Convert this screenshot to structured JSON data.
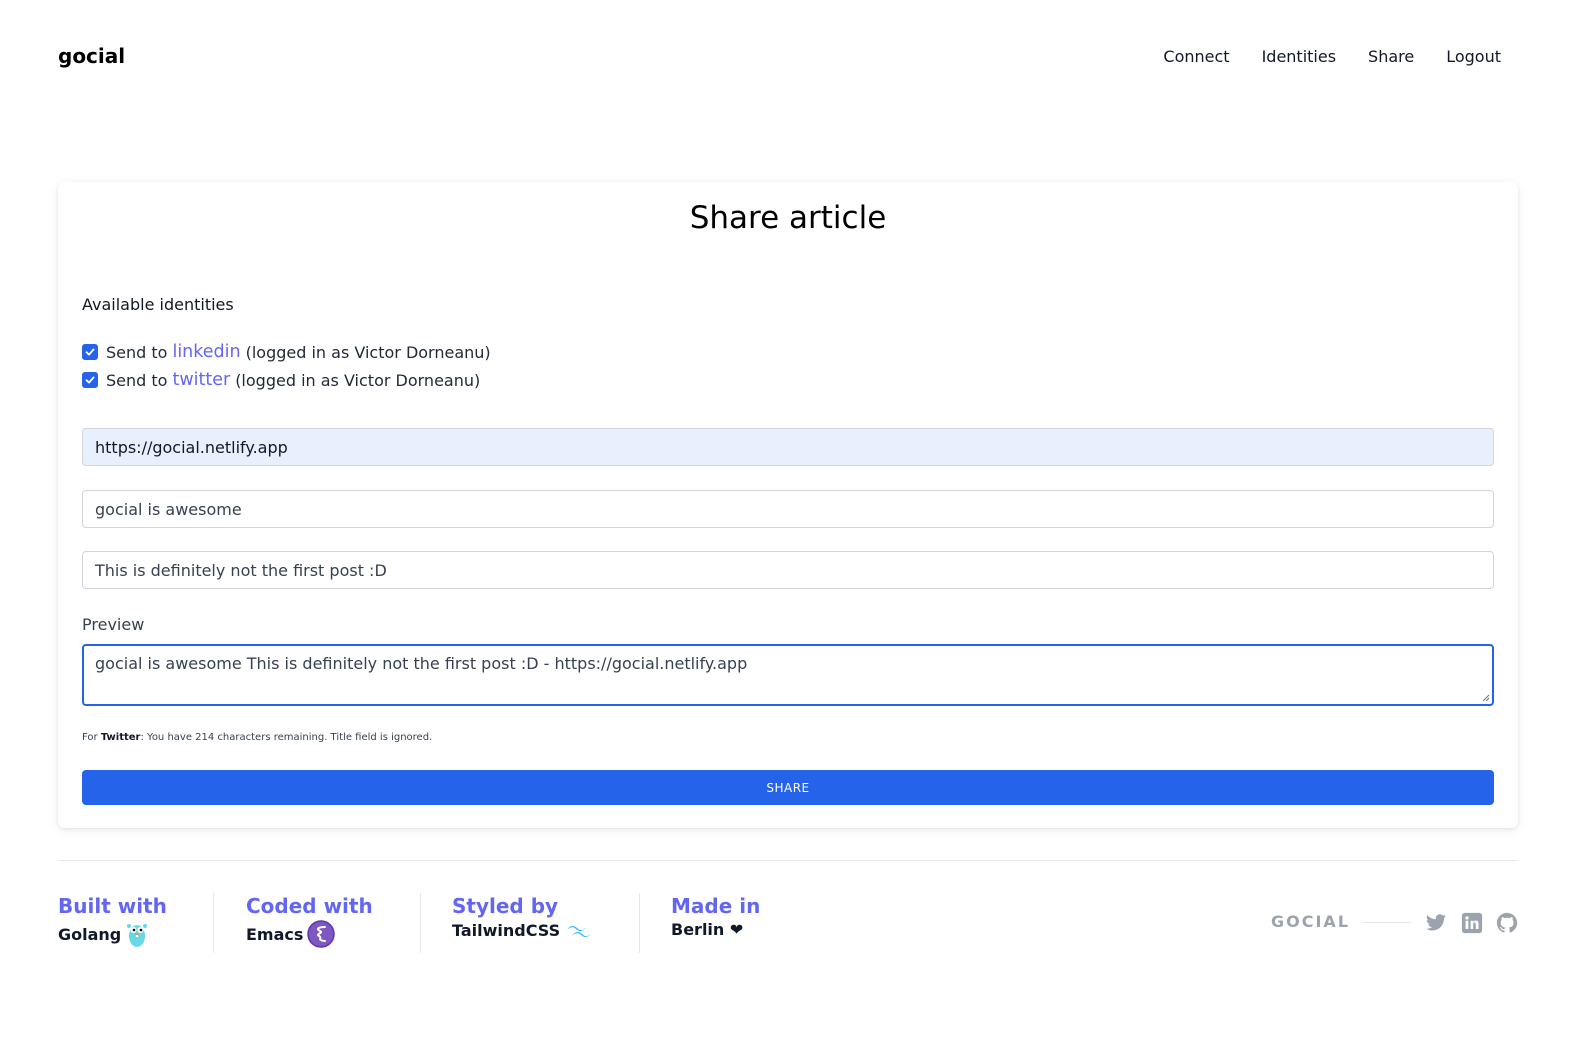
{
  "header": {
    "brand": "gocial",
    "nav": [
      "Connect",
      "Identities",
      "Share",
      "Logout"
    ]
  },
  "card": {
    "title": "Share article",
    "identities_label": "Available identities",
    "identities": [
      {
        "prefix": "Send to",
        "network": "linkedin",
        "suffix": "(logged in as Victor Dorneanu)",
        "checked": true
      },
      {
        "prefix": "Send to",
        "network": "twitter",
        "suffix": "(logged in as Victor Dorneanu)",
        "checked": true
      }
    ],
    "url_value": "https://gocial.netlify.app",
    "title_value": "gocial is awesome",
    "description_value": "This is definitely not the first post :D",
    "preview_label": "Preview",
    "preview_value": "gocial is awesome This is definitely not the first post :D - https://gocial.netlify.app",
    "hint": {
      "pre": "For",
      "network": "Twitter",
      "post": ": You have 214 characters remaining. Title field is ignored."
    },
    "share_label": "SHARE"
  },
  "footer": {
    "cols": [
      {
        "key": "Built with",
        "value": "Golang",
        "icon": "gopher-icon"
      },
      {
        "key": "Coded with",
        "value": "Emacs",
        "icon": "emacs-icon"
      },
      {
        "key": "Styled by",
        "value": "TailwindCSS",
        "icon": "tailwind-icon"
      },
      {
        "key": "Made in",
        "value": "Berlin ❤",
        "icon": ""
      }
    ],
    "brand": "GOCIAL",
    "social": [
      "twitter-icon",
      "linkedin-icon",
      "github-icon"
    ]
  },
  "colors": {
    "accent": "#2563eb",
    "indigo": "#6366f1",
    "url_bg": "#e8f0fe",
    "muted": "#9ca3af"
  }
}
